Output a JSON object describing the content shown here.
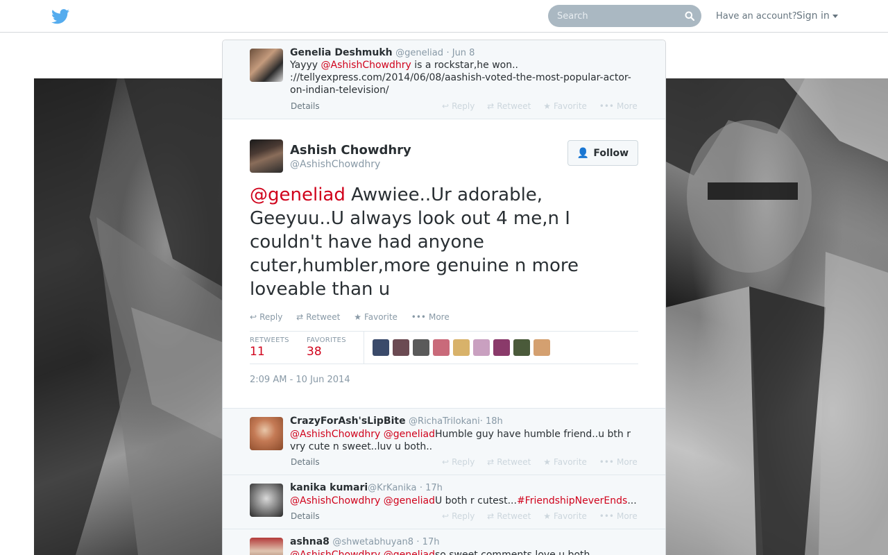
{
  "topbar": {
    "search_placeholder": "Search",
    "have_account": "Have an account?",
    "signin": "Sign in"
  },
  "colors": {
    "accent": "#d0021b",
    "brand": "#55acee"
  },
  "prev_tweet": {
    "name": "Genelia Deshmukh",
    "handle": "@geneliad",
    "time": "· Jun 8",
    "text_pre": "Yayyy ",
    "mention": "@AshishChowdhry",
    "text_post": " is a rockstar,he won.. ://tellyexpress.com/2014/06/08/aashish-voted-the-most-popular-actor-on-indian-television/",
    "details": "Details"
  },
  "actions": {
    "reply": "Reply",
    "retweet": "Retweet",
    "favorite": "Favorite",
    "more": "More"
  },
  "main_tweet": {
    "name": "Ashish Chowdhry",
    "handle": "@AshishChowdhry",
    "follow": "Follow",
    "mention": "@geneliad",
    "text": " Awwiee..Ur adorable, Geeyuu..U always look out 4 me,n I couldn't have had anyone cuter,humbler,more genuine n more loveable than u",
    "retweets_label": "RETWEETS",
    "retweets": "11",
    "favorites_label": "FAVORITES",
    "favorites": "38",
    "timestamp": "2:09 AM - 10 Jun 2014"
  },
  "replies": [
    {
      "name": "CrazyForAsh'sLipBite",
      "handle": "@RichaTrilokani",
      "time": "· 18h",
      "mention1": "@AshishChowdhry",
      "mention2": "@geneliad",
      "text": "Humble guy have humble friend..u bth r vry cute n sweet..luv u both..",
      "details": "Details"
    },
    {
      "name": "kanika kumari",
      "handle": "@KrKanika",
      "time": "· 17h",
      "mention1": "@AshishChowdhry",
      "mention2": "@geneliad",
      "text": "U both r cutest...",
      "hashtag": "#FriendshipNeverEnds",
      "ellipsis": "...",
      "details": "Details"
    },
    {
      "name": "ashna8",
      "handle": "@shwetabhuyan8",
      "time": "· 17h",
      "mention1": "@AshishChowdhry",
      "mention2": "@geneliad",
      "text": "so sweet comments love u both"
    }
  ]
}
